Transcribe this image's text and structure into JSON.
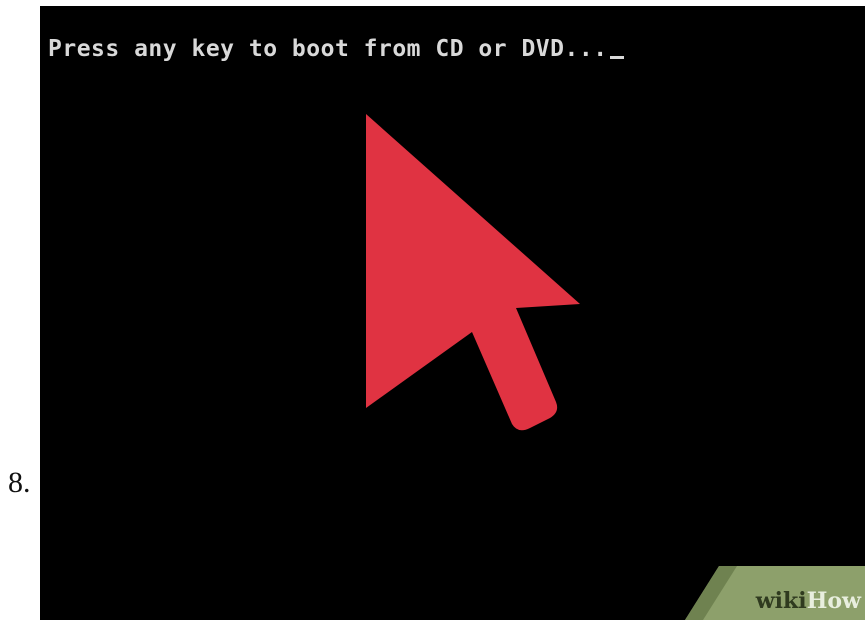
{
  "step": {
    "number": "8."
  },
  "screen": {
    "boot_message": "Press any key to boot from CD or DVD...",
    "cursor_icon": "text-cursor-icon"
  },
  "annotation": {
    "icon": "red-arrow-pointer-icon",
    "color": "#e03342"
  },
  "watermark": {
    "part1": "wiki",
    "part2": "How",
    "color": "#8da06b"
  }
}
